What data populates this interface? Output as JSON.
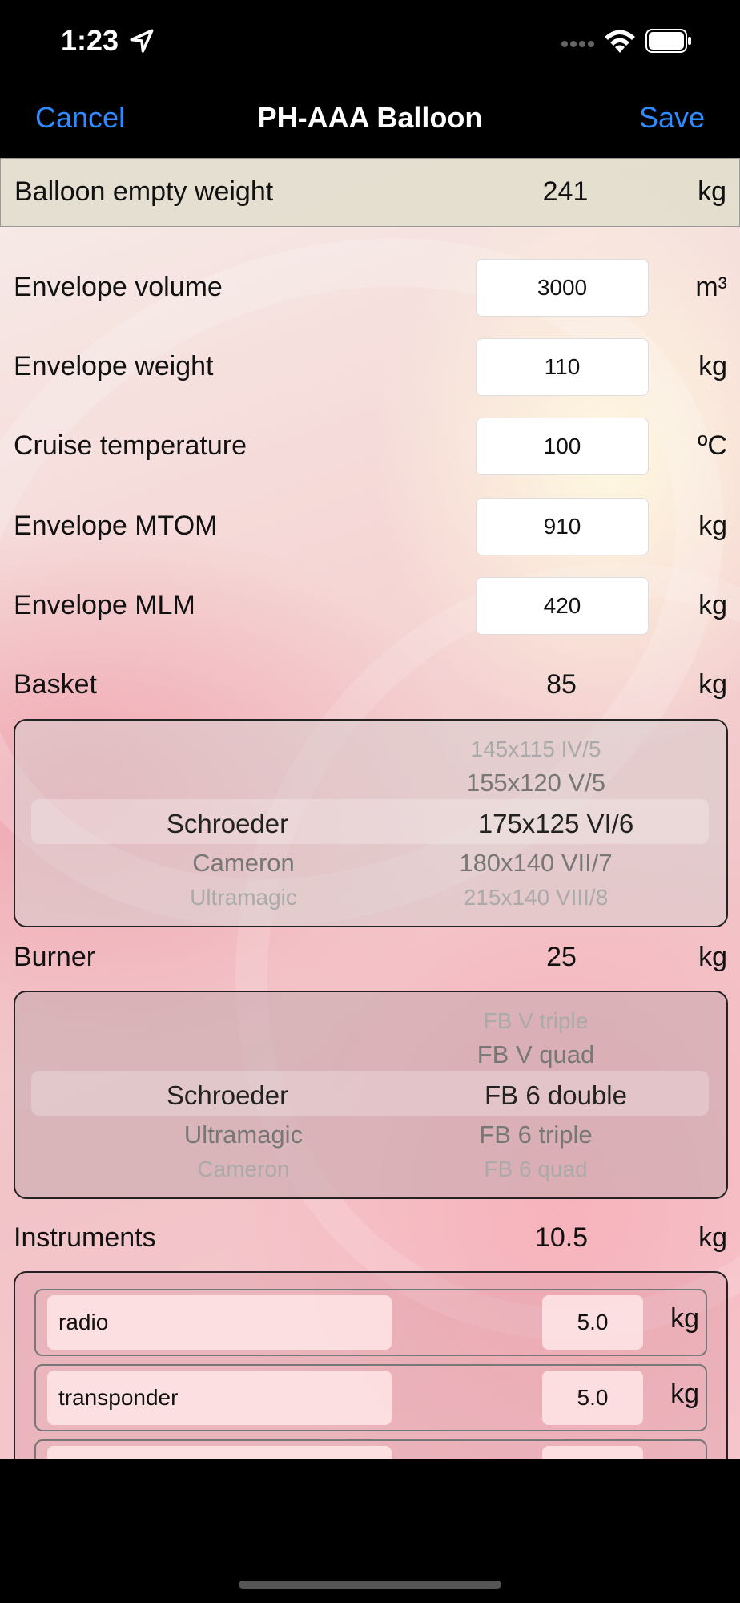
{
  "status": {
    "time": "1:23"
  },
  "nav": {
    "cancel": "Cancel",
    "title": "PH-AAA Balloon",
    "save": "Save"
  },
  "summary": {
    "label": "Balloon empty weight",
    "value": "241",
    "unit": "kg"
  },
  "fields": [
    {
      "label": "Envelope volume",
      "value": "3000",
      "unit": "m³"
    },
    {
      "label": "Envelope weight",
      "value": "110",
      "unit": "kg"
    },
    {
      "label": "Cruise temperature",
      "value": "100",
      "unit": "ºC"
    },
    {
      "label": "Envelope MTOM",
      "value": "910",
      "unit": "kg"
    },
    {
      "label": "Envelope MLM",
      "value": "420",
      "unit": "kg"
    }
  ],
  "basket": {
    "label": "Basket",
    "value": "85",
    "unit": "kg",
    "makes": [
      "Schroeder",
      "Cameron",
      "Ultramagic"
    ],
    "models": [
      "145x115 IV/5",
      "155x120 V/5",
      "175x125 VI/6",
      "180x140 VII/7",
      "215x140 VIII/8"
    ]
  },
  "burner": {
    "label": "Burner",
    "value": "25",
    "unit": "kg",
    "makes": [
      "Schroeder",
      "Ultramagic",
      "Cameron"
    ],
    "models": [
      "FB V triple",
      "FB V quad",
      "FB 6 double",
      "FB 6 triple",
      "FB 6 quad"
    ]
  },
  "instruments": {
    "label": "Instruments",
    "value": "10.5",
    "unit": "kg",
    "items": [
      {
        "name": "radio",
        "weight": "5.0",
        "unit": "kg"
      },
      {
        "name": "transponder",
        "weight": "5.0",
        "unit": "kg"
      }
    ]
  }
}
